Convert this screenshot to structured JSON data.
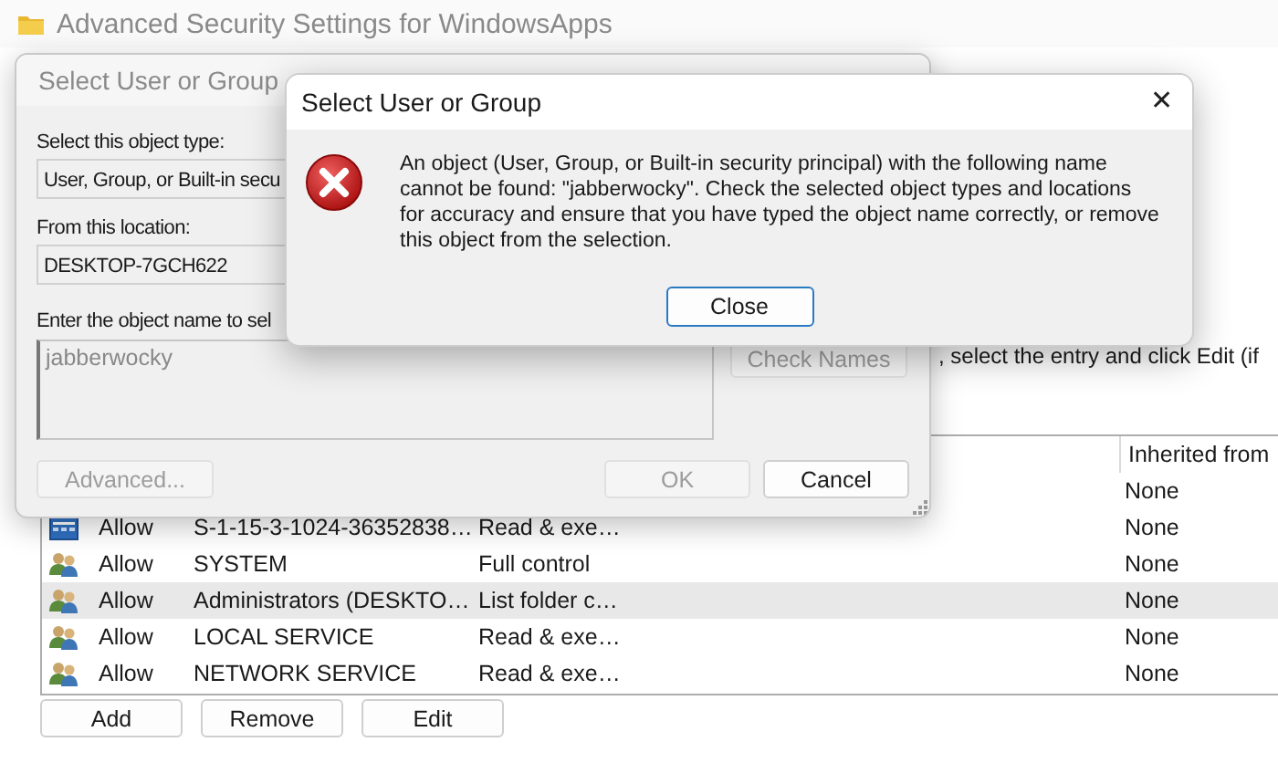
{
  "main_window": {
    "title": "Advanced Security Settings for WindowsApps",
    "active": false,
    "instruction_fragment": ", select the entry and click Edit (if",
    "table": {
      "inherited_header": "Inherited from",
      "rows": [
        {
          "inherited": "None",
          "selected": false
        },
        {
          "kind": "package",
          "type": "Allow",
          "principal": "S-1-15-3-1024-36352838…",
          "access": "Read & exe…",
          "inherited": "None",
          "selected": false
        },
        {
          "kind": "group",
          "type": "Allow",
          "principal": "SYSTEM",
          "access": "Full control",
          "inherited": "None",
          "selected": false
        },
        {
          "kind": "group",
          "type": "Allow",
          "principal": "Administrators (DESKTO…",
          "access": "List folder c…",
          "inherited": "None",
          "selected": true
        },
        {
          "kind": "group",
          "type": "Allow",
          "principal": "LOCAL SERVICE",
          "access": "Read & exe…",
          "inherited": "None",
          "selected": false
        },
        {
          "kind": "group",
          "type": "Allow",
          "principal": "NETWORK SERVICE",
          "access": "Read & exe…",
          "inherited": "None",
          "selected": false
        }
      ]
    },
    "buttons": [
      {
        "label": "Add",
        "disabled": false
      },
      {
        "label": "Remove",
        "disabled": false
      },
      {
        "label": "Edit",
        "disabled": false
      }
    ]
  },
  "select_dialog": {
    "title": "Select User or Group",
    "active": false,
    "object_type_label": "Select this object type:",
    "object_type": "User, Group, or Built-in secu",
    "location_label": "From this location:",
    "location": "DESKTOP-7GCH622",
    "object_name_label": "Enter the object name to sel",
    "object_name": "jabberwocky",
    "check_names": {
      "label": "Check Names",
      "disabled": true
    },
    "advanced": {
      "label": "Advanced...",
      "disabled": true
    },
    "ok": {
      "label": "OK",
      "disabled": true
    },
    "cancel": {
      "label": "Cancel",
      "disabled": false
    }
  },
  "error_dialog": {
    "title": "Select User or Group",
    "active": true,
    "close_glyph": "✕",
    "message": "An object (User, Group, or Built-in security principal) with the following name cannot be found: \"jabberwocky\". Check the selected object types and locations for accuracy and ensure that you have typed the object name correctly, or remove this object from the selection.",
    "button": {
      "label": "Close",
      "default": true,
      "disabled": false
    }
  }
}
